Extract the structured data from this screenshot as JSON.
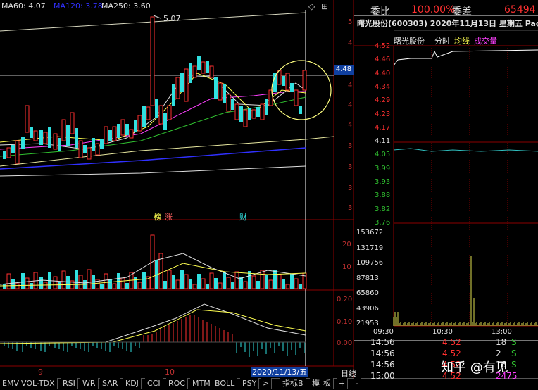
{
  "ma_labels": [
    {
      "text": "MA60: 4.07",
      "color": "#e0e0e0"
    },
    {
      "text": "MA120: 3.78",
      "color": "#3030ff"
    },
    {
      "text": "MA250: 3.60",
      "color": "#e0e0e0"
    }
  ],
  "peak_label": "5.07",
  "price_tag": "4.48",
  "right_axis_main": [
    "5",
    "4",
    "4",
    "4",
    "4",
    "3",
    "3",
    "3",
    "3"
  ],
  "right_axis_vol": [
    "20",
    "10"
  ],
  "right_axis_macd": [
    "0.20",
    "0.10",
    "0.00"
  ],
  "event_marks": {
    "bang": "榜",
    "zhang": "涨",
    "cai": "财"
  },
  "x_axis": {
    "m9": "9",
    "m10": "10",
    "cursor_date": "2020/11/13/五",
    "period": "日线"
  },
  "tabs": [
    "EMV",
    "VOL-TDX",
    "RSI",
    "WR",
    "SAR",
    "KDJ",
    "CCI",
    "ROC",
    "MTM",
    "BOLL",
    "PSY",
    ">",
    "指标B",
    "模",
    "板",
    "+",
    "-"
  ],
  "quote_header": {
    "label_weibi": "委比",
    "weibi_value": "100.00%",
    "label_weicha": "委差",
    "weicha_value": "65494"
  },
  "popup": {
    "title": "曙光股份(600303)  2020年11月13日 星期五 Pag",
    "sub": [
      "曙光股份",
      "分时",
      "均线",
      "成交量"
    ],
    "price_labels": [
      "4.52",
      "4.46",
      "4.40",
      "4.34",
      "4.29",
      "4.23",
      "4.17",
      "4.11",
      "4.05",
      "3.99",
      "3.93",
      "3.88",
      "3.82",
      "3.76"
    ],
    "volume_labels": [
      "153672",
      "131719",
      "109756",
      "87813",
      "65860",
      "43906",
      "21953"
    ],
    "time_labels": [
      "09:30",
      "10:30",
      "13:00"
    ]
  },
  "trades": [
    {
      "time": "14:56",
      "price": "4.52",
      "vol": "18",
      "flag": "S"
    },
    {
      "time": "14:56",
      "price": "4.52",
      "vol": "2",
      "flag": "S"
    },
    {
      "time": "14:56",
      "price": "4.52",
      "vol": "16",
      "flag": "S"
    },
    {
      "time": "15:00",
      "price": "4.52",
      "vol": "2475",
      "flag": ""
    }
  ],
  "watermark": "知乎 @有见",
  "colors": {
    "up": "#ff3030",
    "down": "#30e0e0",
    "grid": "#8b0000"
  }
}
